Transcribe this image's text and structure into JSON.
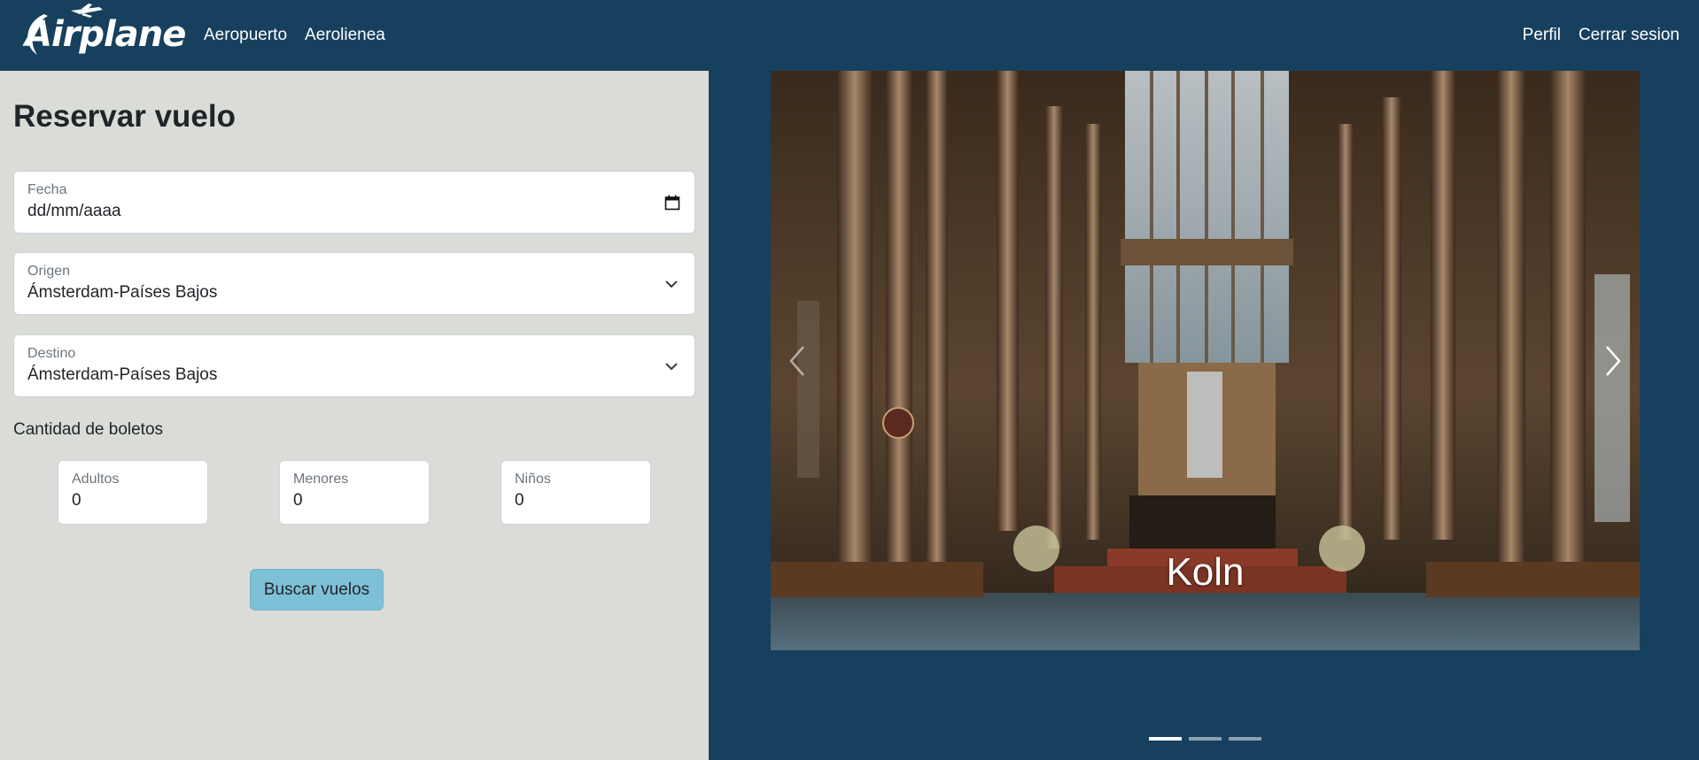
{
  "brand": {
    "name": "Airplane"
  },
  "nav": {
    "left": [
      "Aeropuerto",
      "Aerolienea"
    ],
    "right": [
      "Perfil",
      "Cerrar sesion"
    ]
  },
  "form": {
    "title": "Reservar vuelo",
    "fecha": {
      "label": "Fecha",
      "value": "dd/mm/aaaa"
    },
    "origen": {
      "label": "Origen",
      "value": "Ámsterdam-Países Bajos"
    },
    "destino": {
      "label": "Destino",
      "value": "Ámsterdam-Países Bajos"
    },
    "quantity_label": "Cantidad de boletos",
    "adultos": {
      "label": "Adultos",
      "value": "0"
    },
    "menores": {
      "label": "Menores",
      "value": "0"
    },
    "ninos": {
      "label": "Niños",
      "value": "0"
    },
    "submit_label": "Buscar vuelos"
  },
  "carousel": {
    "caption": "Koln",
    "slide_count": 3,
    "active_index": 0
  },
  "colors": {
    "navbar": "#17405e",
    "panel": "#dadcd8",
    "button": "#7ec0d6"
  }
}
